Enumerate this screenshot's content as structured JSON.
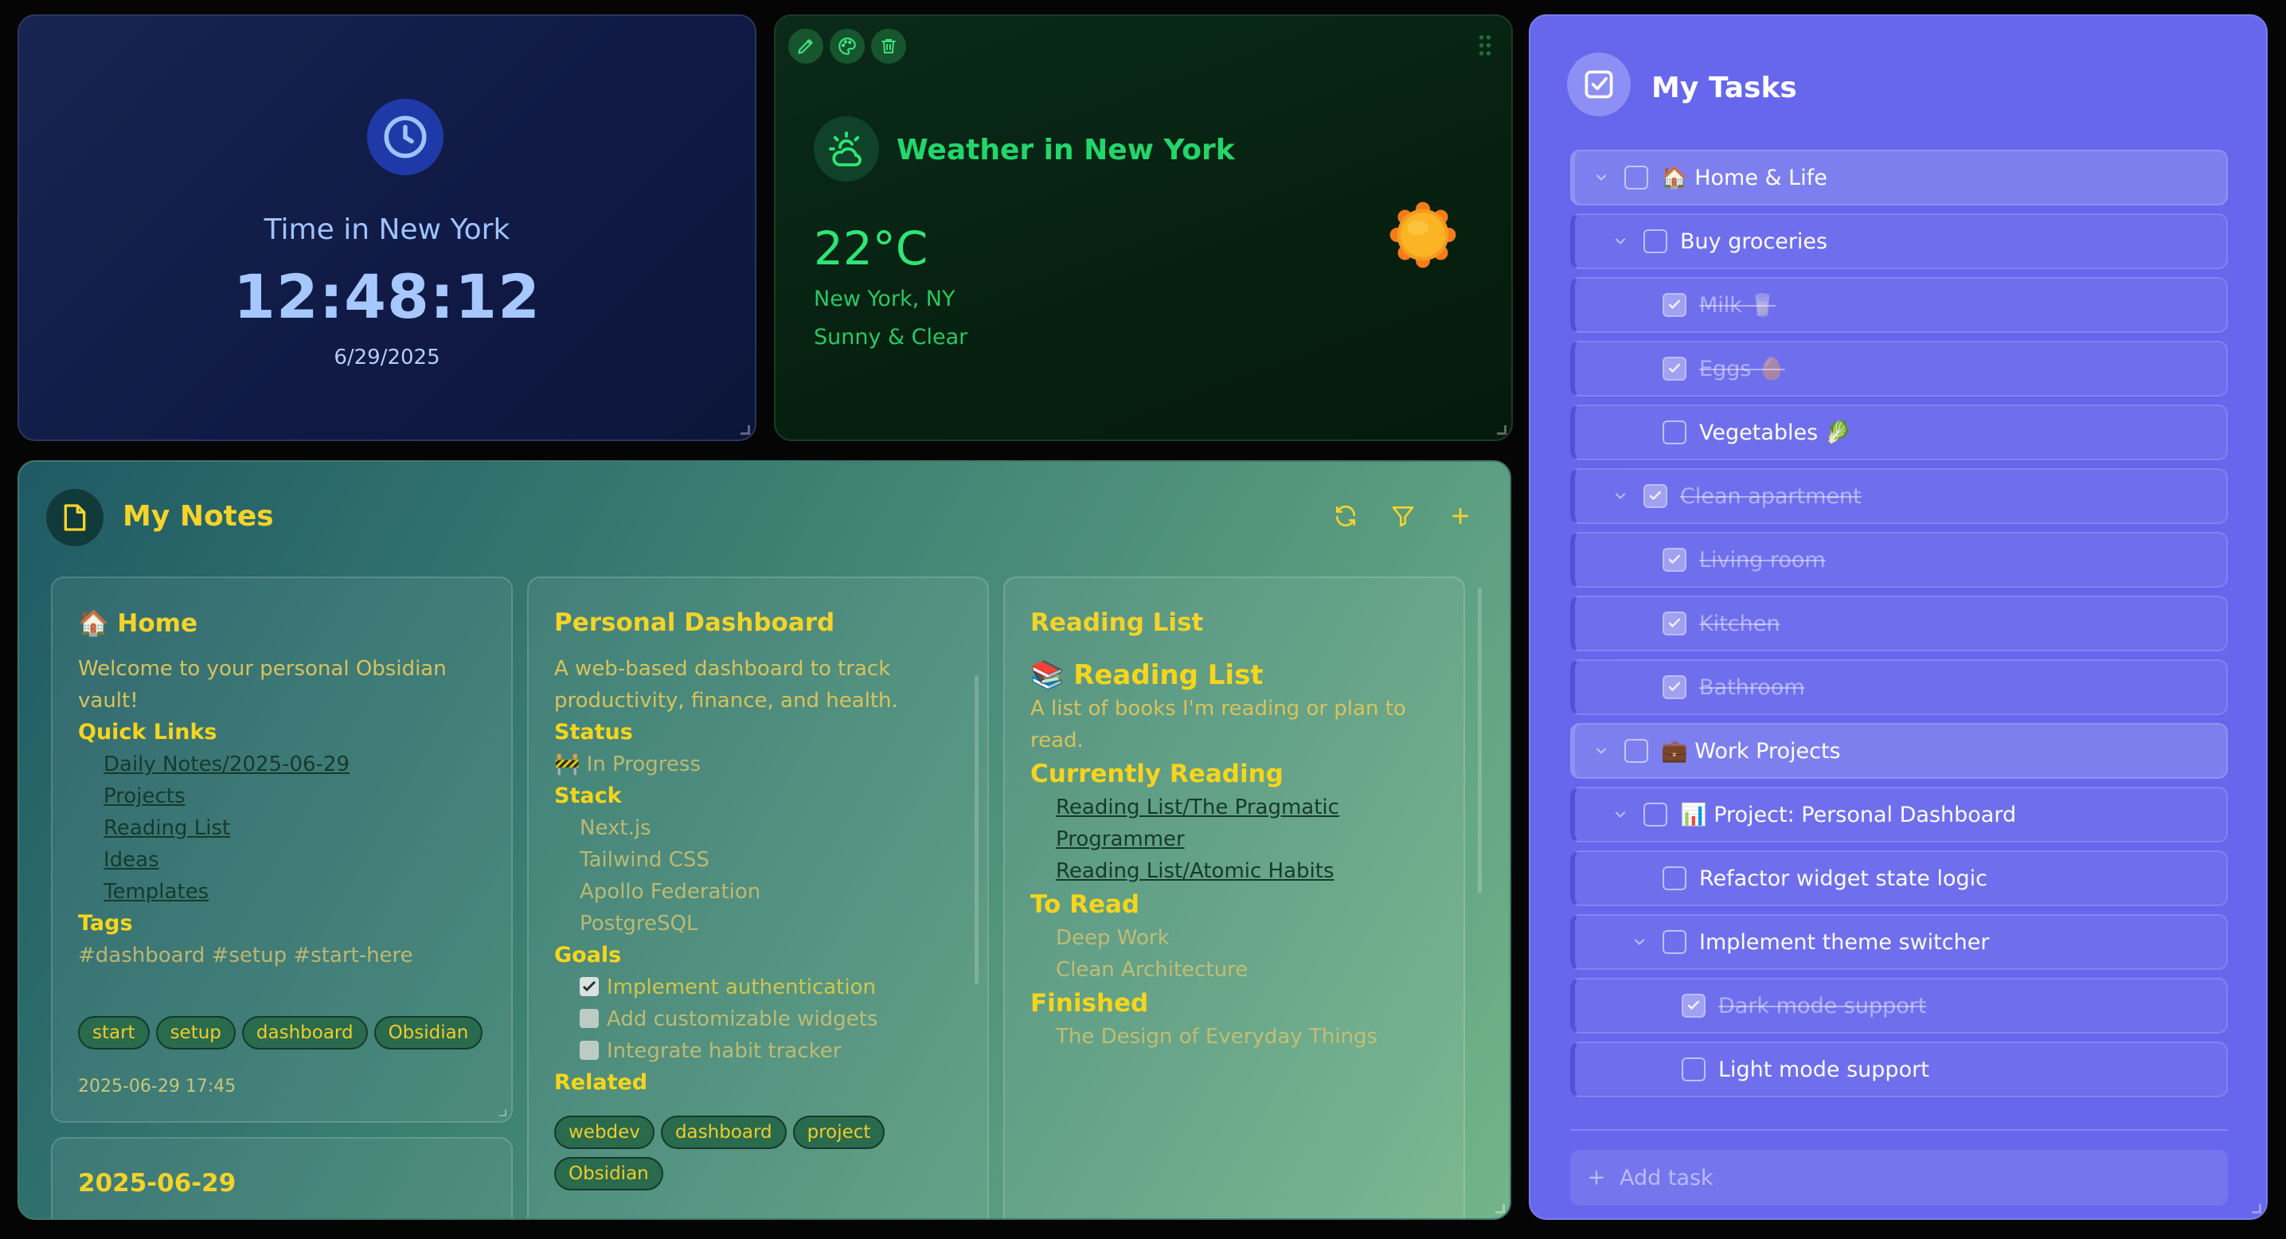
{
  "time_widget": {
    "icon": "clock-icon",
    "title": "Time in New York",
    "time": "12:48:12",
    "date": "6/29/2025",
    "accent": "#a6c8ff"
  },
  "weather_widget": {
    "toolbar_icons": [
      "pencil-icon",
      "palette-icon",
      "trash-icon"
    ],
    "icon": "cloud-sun-icon",
    "title": "Weather in New York",
    "temperature": "22°C",
    "location": "New York, NY",
    "condition": "Sunny & Clear",
    "condition_icon": "sun-icon",
    "accent": "#22d66b"
  },
  "notes_widget": {
    "icon": "note-icon",
    "title": "My Notes",
    "toolbar_icons": [
      "refresh-icon",
      "filter-icon",
      "plus-icon"
    ],
    "accent": "#f5d32a",
    "cards": {
      "home": {
        "emoji": "🏠",
        "title": "Home",
        "intro": "Welcome to your personal Obsidian vault!",
        "quick_links_heading": "Quick Links",
        "links": [
          "Daily Notes/2025-06-29",
          "Projects",
          "Reading List",
          "Ideas",
          "Templates"
        ],
        "tags_heading": "Tags",
        "tags_text": "#dashboard #setup #start-here",
        "tags": [
          "start",
          "setup",
          "dashboard",
          "Obsidian"
        ],
        "timestamp": "2025-06-29 17:45"
      },
      "daily": {
        "title": "2025-06-29"
      },
      "dashboard": {
        "title": "Personal Dashboard",
        "intro": "A web-based dashboard to track productivity, finance, and health.",
        "status_heading": "Status",
        "status_emoji": "🚧",
        "status": "In Progress",
        "stack_heading": "Stack",
        "stack": [
          "Next.js",
          "Tailwind CSS",
          "Apollo Federation",
          "PostgreSQL"
        ],
        "goals_heading": "Goals",
        "goals": [
          {
            "label": "Implement authentication",
            "done": true
          },
          {
            "label": "Add customizable widgets",
            "done": false
          },
          {
            "label": "Integrate habit tracker",
            "done": false
          }
        ],
        "related_heading": "Related",
        "tags": [
          "webdev",
          "dashboard",
          "project",
          "Obsidian"
        ]
      },
      "reading": {
        "title": "Reading List",
        "heading_emoji": "📚",
        "heading": "Reading List",
        "intro": "A list of books I'm reading or plan to read.",
        "currently_heading": "Currently Reading",
        "currently": [
          "Reading List/The Pragmatic Programmer",
          "Reading List/Atomic Habits"
        ],
        "to_read_heading": "To Read",
        "to_read": [
          "Deep Work",
          "Clean Architecture"
        ],
        "finished_heading": "Finished",
        "finished": [
          "The Design of Everyday Things"
        ]
      }
    }
  },
  "tasks_widget": {
    "icon": "checkbox-icon",
    "title": "My Tasks",
    "accent": "#6667ec",
    "tasks": [
      {
        "label": "🏠 Home & Life",
        "level": 0,
        "done": false,
        "expandable": true,
        "group": true
      },
      {
        "label": "Buy groceries",
        "level": 1,
        "done": false,
        "expandable": true,
        "group": false
      },
      {
        "label": "Milk 🥛",
        "level": 2,
        "done": true,
        "expandable": false,
        "group": false
      },
      {
        "label": "Eggs 🥚",
        "level": 2,
        "done": true,
        "expandable": false,
        "group": false
      },
      {
        "label": "Vegetables 🥬",
        "level": 2,
        "done": false,
        "expandable": false,
        "group": false
      },
      {
        "label": "Clean apartment",
        "level": 1,
        "done": true,
        "expandable": true,
        "group": false
      },
      {
        "label": "Living room",
        "level": 2,
        "done": true,
        "expandable": false,
        "group": false
      },
      {
        "label": "Kitchen",
        "level": 2,
        "done": true,
        "expandable": false,
        "group": false
      },
      {
        "label": "Bathroom",
        "level": 2,
        "done": true,
        "expandable": false,
        "group": false
      },
      {
        "label": "💼 Work Projects",
        "level": 0,
        "done": false,
        "expandable": true,
        "group": true
      },
      {
        "label": "📊 Project: Personal Dashboard",
        "level": 1,
        "done": false,
        "expandable": true,
        "group": false
      },
      {
        "label": "Refactor widget state logic",
        "level": 2,
        "done": false,
        "expandable": false,
        "group": false
      },
      {
        "label": "Implement theme switcher",
        "level": 2,
        "done": false,
        "expandable": true,
        "group": false
      },
      {
        "label": "Dark mode support",
        "level": 3,
        "done": true,
        "expandable": false,
        "group": false
      },
      {
        "label": "Light mode support",
        "level": 3,
        "done": false,
        "expandable": false,
        "group": false
      }
    ],
    "add_task_label": "Add task"
  }
}
